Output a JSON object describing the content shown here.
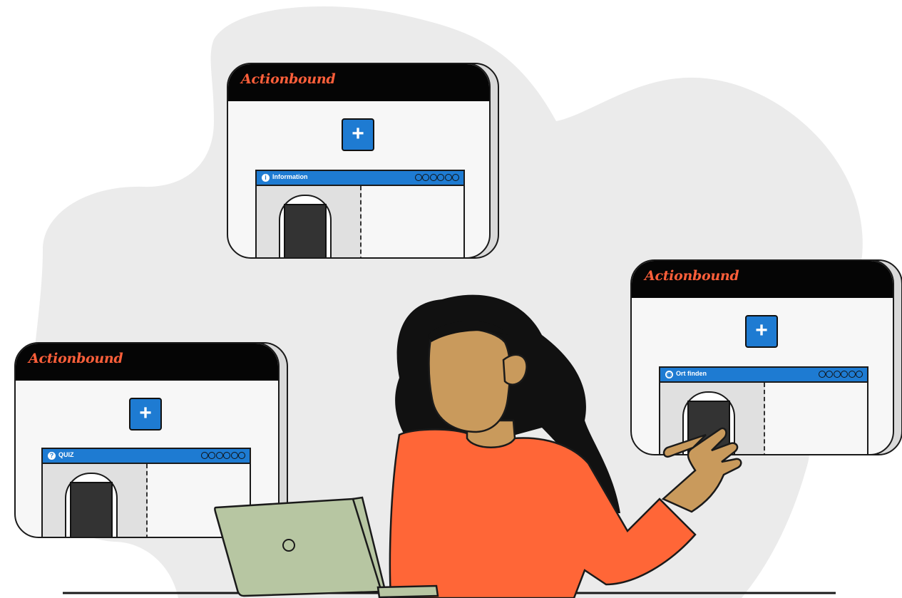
{
  "brand": {
    "name": "Actionbound",
    "logo_color": "#ff5f3a",
    "accent": "#1e7bd2"
  },
  "cards": [
    {
      "id": "information",
      "logo": "Actionbound",
      "add_icon": "plus-icon",
      "add_label": "+",
      "item": {
        "icon": "info-icon",
        "icon_glyph": "i",
        "label": "Information",
        "progress_dots": 6
      }
    },
    {
      "id": "quiz",
      "logo": "Actionbound",
      "add_icon": "plus-icon",
      "add_label": "+",
      "item": {
        "icon": "question-icon",
        "icon_glyph": "?",
        "label": "QUIZ",
        "progress_dots": 6
      }
    },
    {
      "id": "ort-finden",
      "logo": "Actionbound",
      "add_icon": "plus-icon",
      "add_label": "+",
      "item": {
        "icon": "location-icon",
        "icon_glyph": "◉",
        "label": "Ort finden",
        "progress_dots": 6
      }
    }
  ],
  "illustration": {
    "person": "woman-pointing",
    "device": "laptop",
    "skin": "#c99a5c",
    "shirt": "#ff6637",
    "laptop": "#b7c6a2",
    "blob": "#ebebeb"
  }
}
